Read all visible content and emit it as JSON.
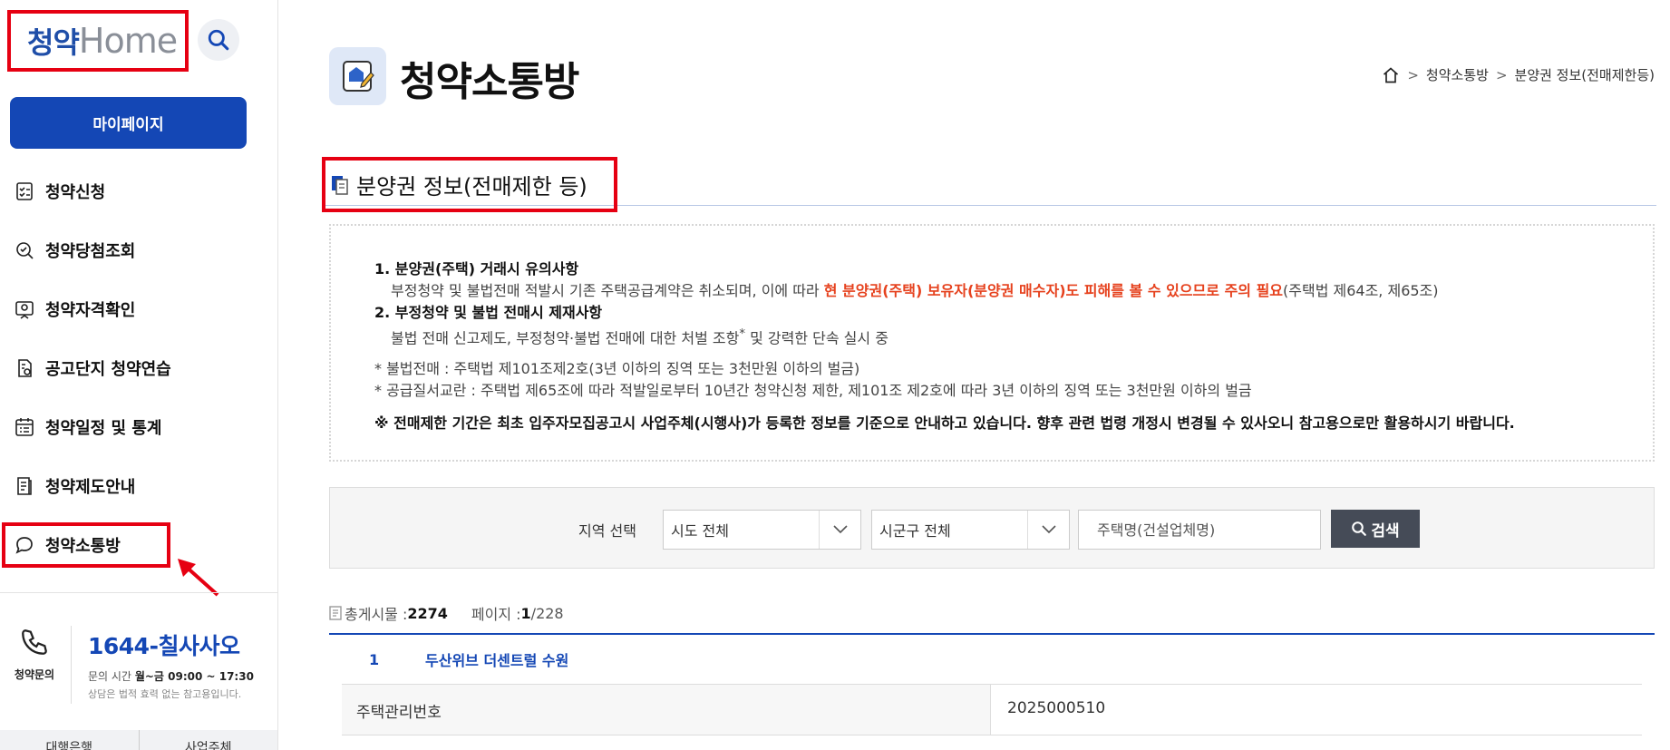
{
  "sidebar": {
    "logo_ko": "청약",
    "logo_en": "Home",
    "mypage_label": "마이페이지",
    "nav": [
      {
        "label": "청약신청",
        "icon": "checklist-icon"
      },
      {
        "label": "청약당첨조회",
        "icon": "check-search-icon"
      },
      {
        "label": "청약자격확인",
        "icon": "id-check-icon"
      },
      {
        "label": "공고단지 청약연습",
        "icon": "practice-icon"
      },
      {
        "label": "청약일정 및 통계",
        "icon": "calendar-list-icon"
      },
      {
        "label": "청약제도안내",
        "icon": "document-icon"
      },
      {
        "label": "청약소통방",
        "icon": "chat-bubble-icon"
      }
    ],
    "contact": {
      "label": "청약문의",
      "number": "1644-칠사사오",
      "hours_prefix": "문의 시간",
      "hours_value": "월~금 09:00 ~ 17:30",
      "note": "상담은 법적 효력 없는 참고용입니다."
    },
    "bottom_tabs": [
      "대행은행",
      "사업주체"
    ]
  },
  "main": {
    "page_title": "청약소통방",
    "breadcrumb": [
      "청약소통방",
      "분양권 정보(전매제한등)"
    ],
    "section_title": "분양권 정보(전매제한 등)",
    "notice": {
      "item1_title": "1. 분양권(주택) 거래시 유의사항",
      "item1_text_a": "부정청약 및 불법전매 적발시 기존 주택공급계약은 취소되며, 이에 따라 ",
      "item1_text_red": "현 분양권(주택) 보유자(분양권 매수자)도 피해를 볼 수 있으므로 주의 필요",
      "item1_text_b": "(주택법 제64조, 제65조)",
      "item2_title": "2. 부정청약 및 불법 전매시 제재사항",
      "item2_text_a": "불법 전매 신고제도, 부정청약·불법 전매에 대한 처벌 조항",
      "item2_sup": "*",
      "item2_text_b": " 및 강력한 단속 실시 중",
      "star1": "* 불법전매 : 주택법 제101조제2호(3년 이하의 징역 또는 3천만원 이하의 벌금)",
      "star2": "* 공급질서교란 : 주택법 제65조에 따라 적발일로부터 10년간 청약신청 제한, 제101조 제2호에 따라 3년 이하의 징역 또는 3천만원 이하의 벌금",
      "warning": "※ 전매제한 기간은 최초 입주자모집공고시 사업주체(시행사)가 등록한 정보를 기준으로 안내하고 있습니다. 향후 관련 법령 개정시 변경될 수 있사오니 참고용으로만 활용하시기 바랍니다."
    },
    "search": {
      "region_label": "지역 선택",
      "sido_value": "시도 전체",
      "sigungu_value": "시군구 전체",
      "name_placeholder": "주택명(건설업체명)",
      "submit_label": "검색"
    },
    "counts": {
      "total_label": "총게시물 : ",
      "total_value": "2274",
      "page_label": "페이지 : ",
      "page_current": "1",
      "page_total": "/228"
    },
    "list": [
      {
        "num": "1",
        "name": "두산위브 더센트럴 수원",
        "detail_key": "주택관리번호",
        "detail_value": "2025000510"
      }
    ]
  }
}
